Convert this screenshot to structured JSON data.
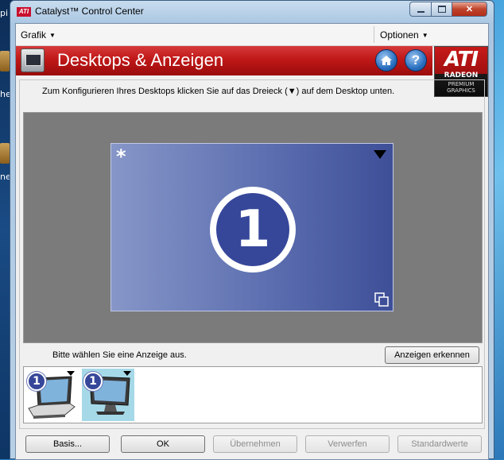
{
  "window": {
    "title": "Catalyst™ Control Center",
    "title_logo": "ATI"
  },
  "desktop": {
    "icon_labels": [
      "pi",
      "he",
      "ne"
    ]
  },
  "menubar": {
    "left_menu": "Grafik",
    "right_menu": "Optionen"
  },
  "banner": {
    "title": "Desktops & Anzeigen",
    "home_icon": "home-icon",
    "help_label": "?"
  },
  "ati_badge": {
    "brand": "ATI",
    "product": "RADEON",
    "line1": "PREMIUM",
    "line2": "GRAPHICS"
  },
  "instruction": "Zum Konfigurieren Ihres Desktops klicken Sie auf das Dreieck (▼) auf dem Desktop unten.",
  "desktop_canvas": {
    "star": "*",
    "monitor_number": "1"
  },
  "display_select": {
    "label": "Bitte wählen Sie eine Anzeige aus.",
    "identify_button": "Anzeigen erkennen"
  },
  "thumbnails": [
    {
      "number": "1",
      "kind": "laptop"
    },
    {
      "number": "1",
      "kind": "monitor",
      "selected": true
    }
  ],
  "footer": {
    "basic": "Basis...",
    "ok": "OK",
    "apply": "Übernehmen",
    "discard": "Verwerfen",
    "defaults": "Standardwerte"
  },
  "colors": {
    "banner_red": "#c01818",
    "monitor_blue": "#36479a",
    "selected_thumb": "#a6d9e8"
  }
}
